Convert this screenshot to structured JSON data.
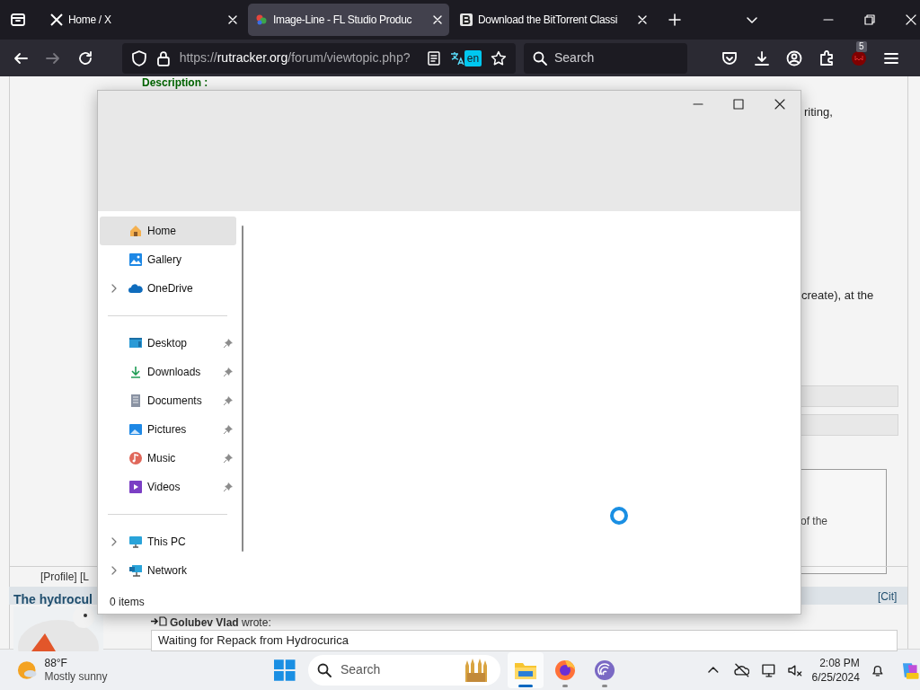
{
  "browser": {
    "tabs": [
      {
        "title": "Home / X",
        "kind": "x",
        "selected": false
      },
      {
        "title": "Image-Line - FL Studio Produc",
        "kind": "fl",
        "selected": true
      },
      {
        "title": "Download the BitTorrent Classi",
        "kind": "b",
        "selected": false
      }
    ],
    "url": {
      "scheme": "https://",
      "host": "rutracker.org",
      "path": "/forum/viewtopic.php?"
    },
    "translate_badge": "en",
    "search_placeholder": "Search",
    "extension_badge": "5"
  },
  "page": {
    "description_label": "Description :",
    "fragment_1": "riting,",
    "fragment_2": "create), at the",
    "fragment_3": "of the",
    "profile_links": "[Profile] [L",
    "post_title": "The hydrocul",
    "cite_link": "[Cit]",
    "quote_author": "Golubev Vlad",
    "quote_verb": "wrote:",
    "quote_text": "Waiting for Repack from Hydrocurica"
  },
  "explorer": {
    "nav_sections": [
      [
        {
          "label": "Home",
          "kind": "home",
          "selected": true,
          "expandable": false,
          "pinned": false
        },
        {
          "label": "Gallery",
          "kind": "gallery",
          "selected": false,
          "expandable": false,
          "pinned": false
        },
        {
          "label": "OneDrive",
          "kind": "cloud",
          "selected": false,
          "expandable": true,
          "pinned": false
        }
      ],
      [
        {
          "label": "Desktop",
          "kind": "desktop",
          "selected": false,
          "expandable": false,
          "pinned": true
        },
        {
          "label": "Downloads",
          "kind": "download",
          "selected": false,
          "expandable": false,
          "pinned": true
        },
        {
          "label": "Documents",
          "kind": "document",
          "selected": false,
          "expandable": false,
          "pinned": true
        },
        {
          "label": "Pictures",
          "kind": "pictures",
          "selected": false,
          "expandable": false,
          "pinned": true
        },
        {
          "label": "Music",
          "kind": "music",
          "selected": false,
          "expandable": false,
          "pinned": true
        },
        {
          "label": "Videos",
          "kind": "videos",
          "selected": false,
          "expandable": false,
          "pinned": true
        }
      ],
      [
        {
          "label": "This PC",
          "kind": "pc",
          "selected": false,
          "expandable": true,
          "pinned": false
        },
        {
          "label": "Network",
          "kind": "network",
          "selected": false,
          "expandable": true,
          "pinned": false
        }
      ]
    ],
    "status": "0 items"
  },
  "taskbar": {
    "temperature": "88°F",
    "condition": "Mostly sunny",
    "search_placeholder": "Search",
    "apps": [
      {
        "kind": "folder",
        "active": true
      },
      {
        "kind": "firefox",
        "active": false
      },
      {
        "kind": "torrent",
        "active": false
      }
    ],
    "time": "2:08 PM",
    "date": "6/25/2024"
  }
}
